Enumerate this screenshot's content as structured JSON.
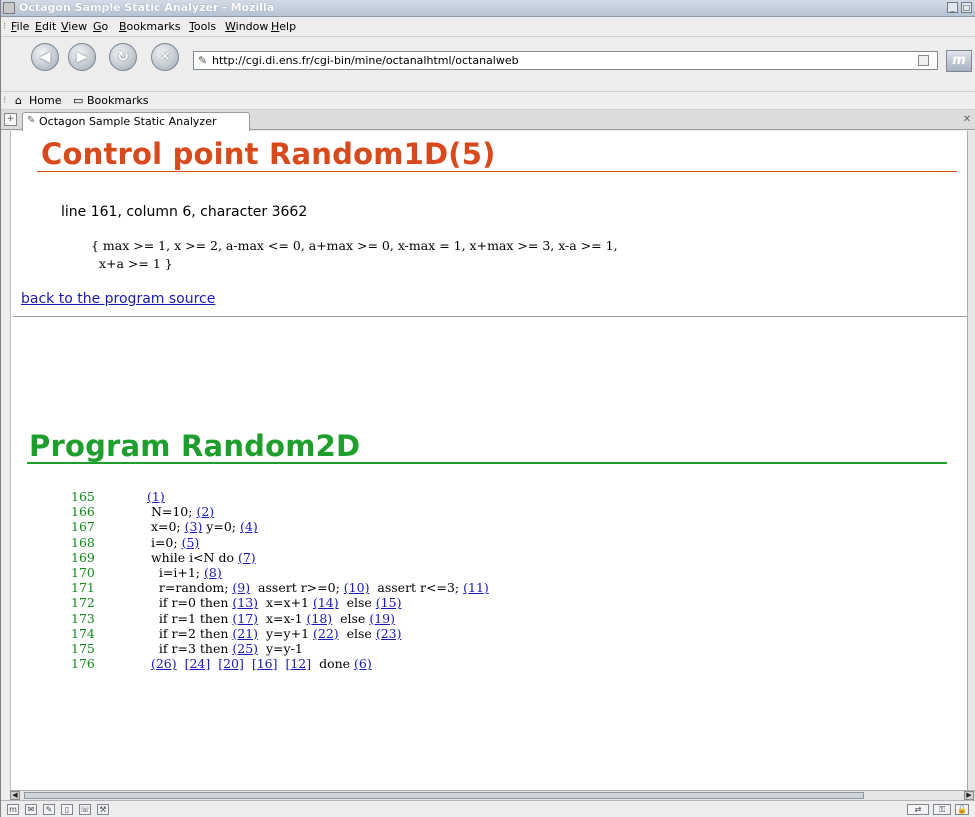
{
  "window": {
    "title": "Octagon Sample Static Analyzer - Mozilla",
    "controls": [
      "minimize",
      "maximize"
    ]
  },
  "menubar": {
    "items": [
      "File",
      "Edit",
      "View",
      "Go",
      "Bookmarks",
      "Tools",
      "Window",
      "Help"
    ]
  },
  "navigation": {
    "url": "http://cgi.di.ens.fr/cgi-bin/mine/octanalhtml/octanalweb",
    "buttons": [
      "back-icon",
      "forward-icon",
      "reload-icon",
      "stop-icon"
    ]
  },
  "personal_toolbar": {
    "home_label": "Home",
    "bookmarks_label": "Bookmarks"
  },
  "tabs": [
    {
      "label": "Octagon Sample Static Analyzer"
    }
  ],
  "page": {
    "control_point_heading": "Control point Random1D(5)",
    "location": "line 161, column 6, character 3662",
    "invariant_line1": "{ max >= 1, x >= 2, a-max <= 0, a+max >= 0, x-max = 1, x+max >= 3, x-a >= 1,",
    "invariant_line2": "  x+a >= 1 }",
    "back_link": "back to the program source",
    "program_heading": "Program Random2D",
    "code": [
      {
        "line": "165",
        "parts": [
          {
            "t": " "
          },
          {
            "a": "(1)"
          }
        ]
      },
      {
        "line": "166",
        "parts": [
          {
            "t": "  N=10; "
          },
          {
            "a": "(2)"
          }
        ]
      },
      {
        "line": "167",
        "parts": [
          {
            "t": "  x=0; "
          },
          {
            "a": "(3)"
          },
          {
            "t": " y=0; "
          },
          {
            "a": "(4)"
          }
        ]
      },
      {
        "line": "168",
        "parts": [
          {
            "t": "  i=0; "
          },
          {
            "a": "(5)"
          }
        ]
      },
      {
        "line": "169",
        "parts": [
          {
            "t": "  while i<N do "
          },
          {
            "a": "(7)"
          }
        ]
      },
      {
        "line": "170",
        "parts": [
          {
            "t": "    i=i+1; "
          },
          {
            "a": "(8)"
          }
        ]
      },
      {
        "line": "171",
        "parts": [
          {
            "t": "    r=random; "
          },
          {
            "a": "(9)"
          },
          {
            "t": "  assert r>=0; "
          },
          {
            "a": "(10)"
          },
          {
            "t": "  assert r<=3; "
          },
          {
            "a": "(11)"
          }
        ]
      },
      {
        "line": "172",
        "parts": [
          {
            "t": "    if r=0 then "
          },
          {
            "a": "(13)"
          },
          {
            "t": "  x=x+1 "
          },
          {
            "a": "(14)"
          },
          {
            "t": "  else "
          },
          {
            "a": "(15)"
          }
        ]
      },
      {
        "line": "173",
        "parts": [
          {
            "t": "    if r=1 then "
          },
          {
            "a": "(17)"
          },
          {
            "t": "  x=x-1 "
          },
          {
            "a": "(18)"
          },
          {
            "t": "  else "
          },
          {
            "a": "(19)"
          }
        ]
      },
      {
        "line": "174",
        "parts": [
          {
            "t": "    if r=2 then "
          },
          {
            "a": "(21)"
          },
          {
            "t": "  y=y+1 "
          },
          {
            "a": "(22)"
          },
          {
            "t": "  else "
          },
          {
            "a": "(23)"
          }
        ]
      },
      {
        "line": "175",
        "parts": [
          {
            "t": "    if r=3 then "
          },
          {
            "a": "(25)"
          },
          {
            "t": "  y=y-1"
          }
        ]
      },
      {
        "line": "176",
        "parts": [
          {
            "t": "  "
          },
          {
            "a": "(26)"
          },
          {
            "t": "  "
          },
          {
            "a": "[24]"
          },
          {
            "t": "  "
          },
          {
            "a": "[20]"
          },
          {
            "t": "  "
          },
          {
            "a": "[16]"
          },
          {
            "t": "  "
          },
          {
            "a": "[12]"
          },
          {
            "t": "  done "
          },
          {
            "a": "(6)"
          }
        ]
      }
    ]
  },
  "colors": {
    "control_point_heading": "#d8491c",
    "program_heading": "#1e9e2c",
    "line_numbers": "#128a1d",
    "link": "#1a1ab8"
  }
}
